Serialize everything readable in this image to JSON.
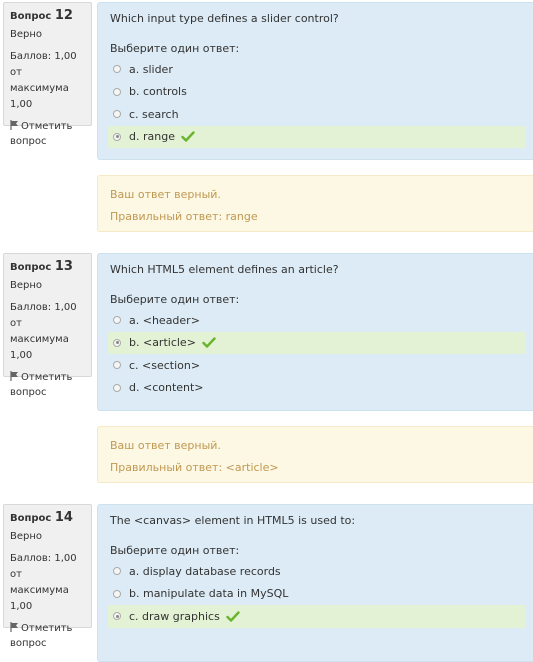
{
  "colors": {
    "formulation_bg": "#dcebf5",
    "outcome_bg": "#fcf8e3",
    "outcome_text": "#c09853",
    "correct_bg": "#e3f1d4",
    "check_green": "#6ab42d"
  },
  "questions": [
    {
      "label": "Вопрос",
      "number": "12",
      "state": "Верно",
      "grade_line1": "Баллов: 1,00 от",
      "grade_line2": "максимума 1,00",
      "flag_line1": "Отметить",
      "flag_line2": "вопрос",
      "text": "Which input type defines a slider control?",
      "prompt": "Выберите один ответ:",
      "answers": [
        {
          "text": "a. slider"
        },
        {
          "text": "b. controls"
        },
        {
          "text": "c. search"
        },
        {
          "text": "d. range"
        }
      ],
      "selected_index": 3,
      "feedback": "Ваш ответ верный.",
      "right_answer": "Правильный ответ: range"
    },
    {
      "label": "Вопрос",
      "number": "13",
      "state": "Верно",
      "grade_line1": "Баллов: 1,00 от",
      "grade_line2": "максимума 1,00",
      "flag_line1": "Отметить",
      "flag_line2": "вопрос",
      "text": "Which HTML5 element defines an article?",
      "prompt": "Выберите один ответ:",
      "answers": [
        {
          "text": "a. <header>"
        },
        {
          "text": "b. <article>"
        },
        {
          "text": "c. <section>"
        },
        {
          "text": "d. <content>"
        }
      ],
      "selected_index": 1,
      "feedback": "Ваш ответ верный.",
      "right_answer": "Правильный ответ: <article>"
    },
    {
      "label": "Вопрос",
      "number": "14",
      "state": "Верно",
      "grade_line1": "Баллов: 1,00 от",
      "grade_line2": "максимума 1,00",
      "flag_line1": "Отметить",
      "flag_line2": "вопрос",
      "text": "The <canvas> element in HTML5 is used to:",
      "prompt": "Выберите один ответ:",
      "answers": [
        {
          "text": "a. display database records"
        },
        {
          "text": "b. manipulate data in MySQL"
        },
        {
          "text": "c. draw graphics"
        }
      ],
      "selected_index": 2
    }
  ]
}
